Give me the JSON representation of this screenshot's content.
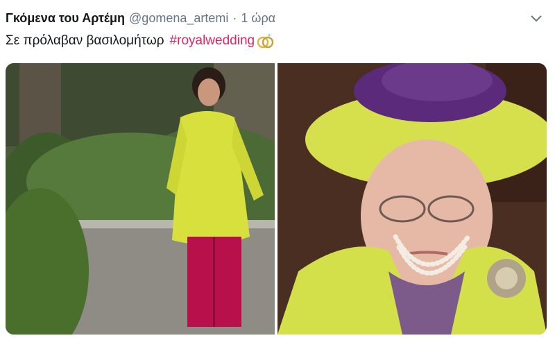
{
  "tweet": {
    "author_name": "Γκόμενα του Αρτέμη",
    "handle": "@gomena_artemi",
    "separator": "·",
    "timestamp": "1 ώρα",
    "text": "Σε πρόλαβαν βασιλομήτωρ",
    "hashtag": "#royalwedding",
    "emoji": "rings-emoji-icon"
  },
  "media": {
    "photos": [
      {
        "subject": "woman-yellow-coat-pink-trousers"
      },
      {
        "subject": "elderly-woman-lime-hat-pearls"
      }
    ]
  },
  "colors": {
    "name": "#14171a",
    "secondary": "#657786",
    "hashtag": "#e0245e",
    "lime_coat": "#d4e04a"
  },
  "icons": {
    "menu": "chevron-down-icon"
  }
}
